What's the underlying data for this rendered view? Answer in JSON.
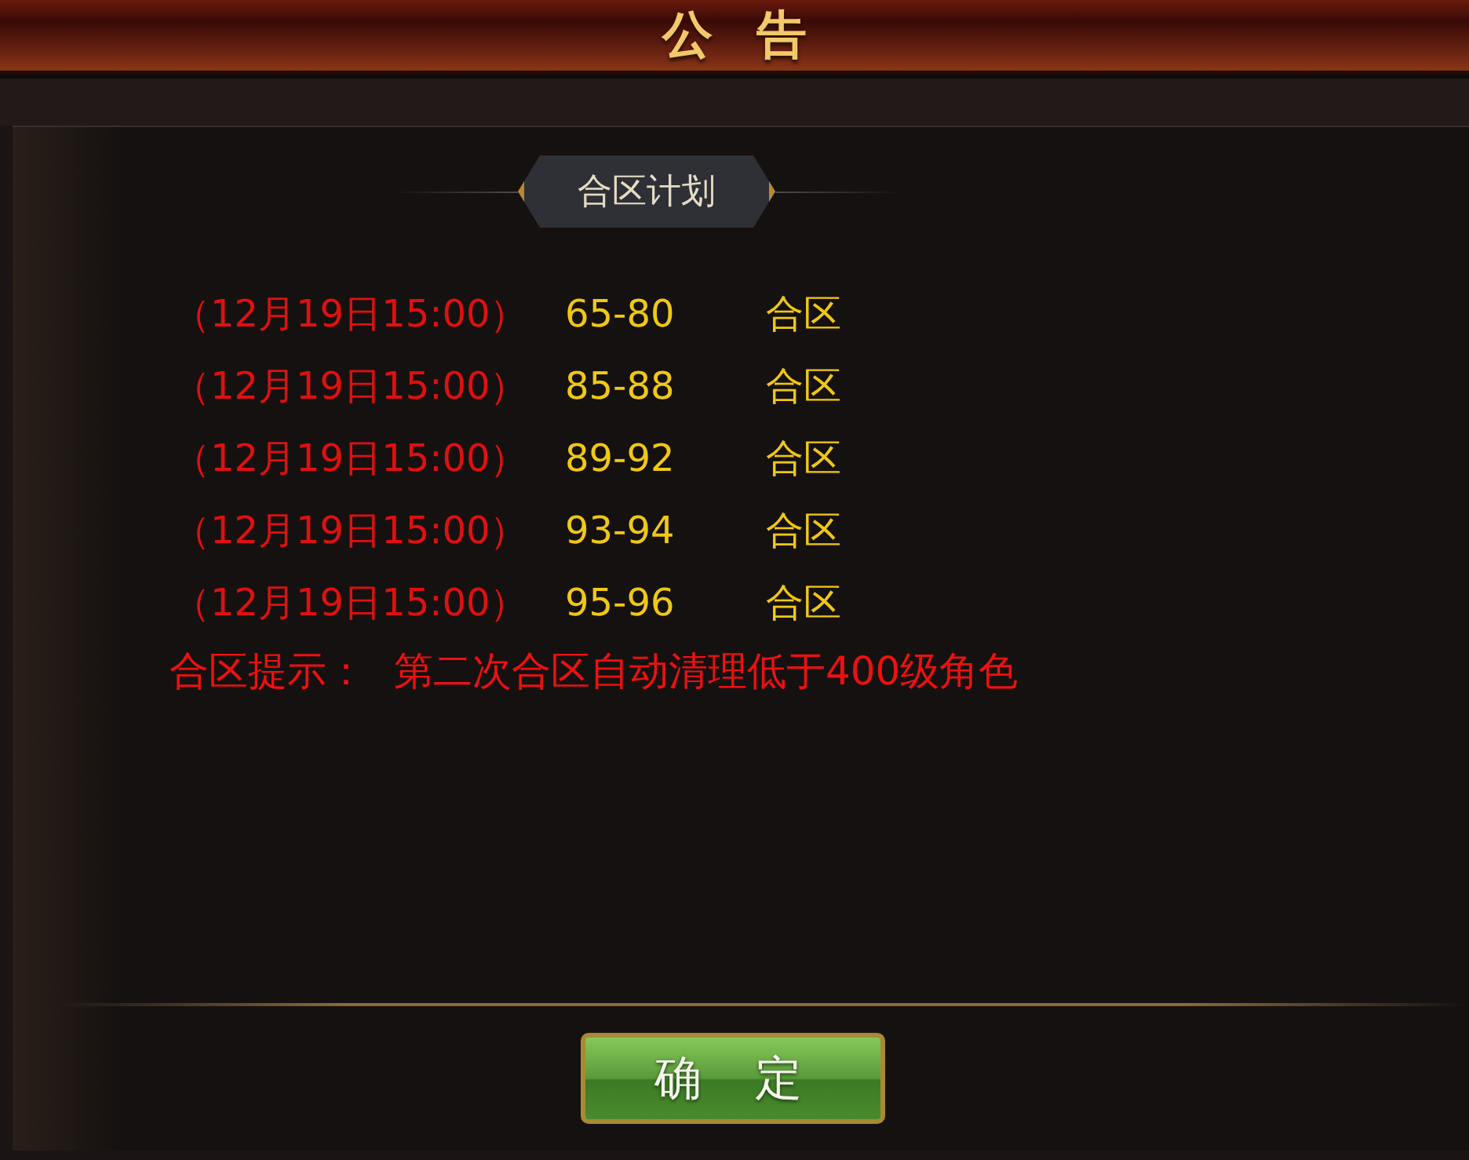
{
  "window": {
    "title": "公告"
  },
  "section": {
    "title": "合区计划"
  },
  "schedule": [
    {
      "time": "（12月19日15:00）",
      "servers": "65-80",
      "action": "合区"
    },
    {
      "time": "（12月19日15:00）",
      "servers": "85-88",
      "action": "合区"
    },
    {
      "time": "（12月19日15:00）",
      "servers": "89-92",
      "action": "合区"
    },
    {
      "time": "（12月19日15:00）",
      "servers": "93-94",
      "action": "合区"
    },
    {
      "time": "（12月19日15:00）",
      "servers": "95-96",
      "action": "合区"
    }
  ],
  "notice": {
    "label": "合区提示：",
    "text": "第二次合区自动清理低于400级角色"
  },
  "buttons": [
    "确定"
  ]
}
